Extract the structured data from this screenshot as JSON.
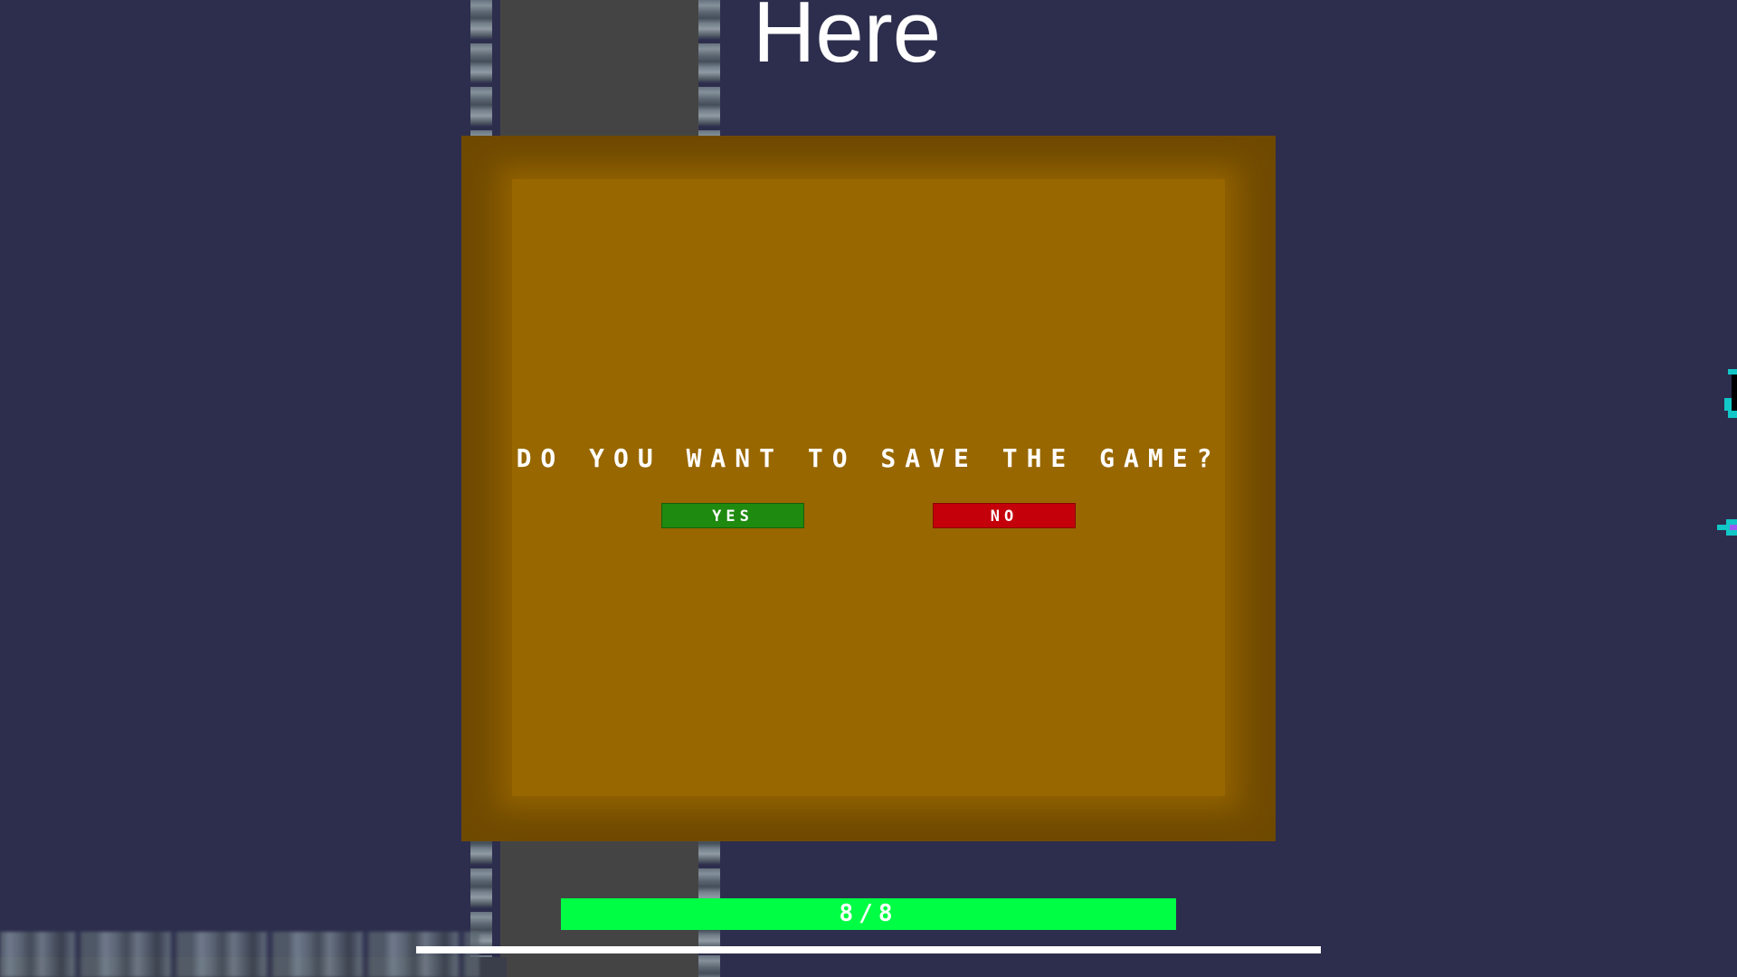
{
  "title": "Here",
  "dialog": {
    "prompt": "DO YOU WANT TO SAVE THE GAME?",
    "yes_label": "YES",
    "no_label": "NO"
  },
  "health": {
    "label": "8/8",
    "current": 8,
    "max": 8,
    "color": "#00ff44"
  },
  "progress": {
    "fraction": 1.0
  },
  "colors": {
    "background": "#2d2e4d",
    "dialog_outer": "#7a5200",
    "dialog_inner": "#986700",
    "yes_button": "#1f8a10",
    "no_button": "#c4000a"
  }
}
